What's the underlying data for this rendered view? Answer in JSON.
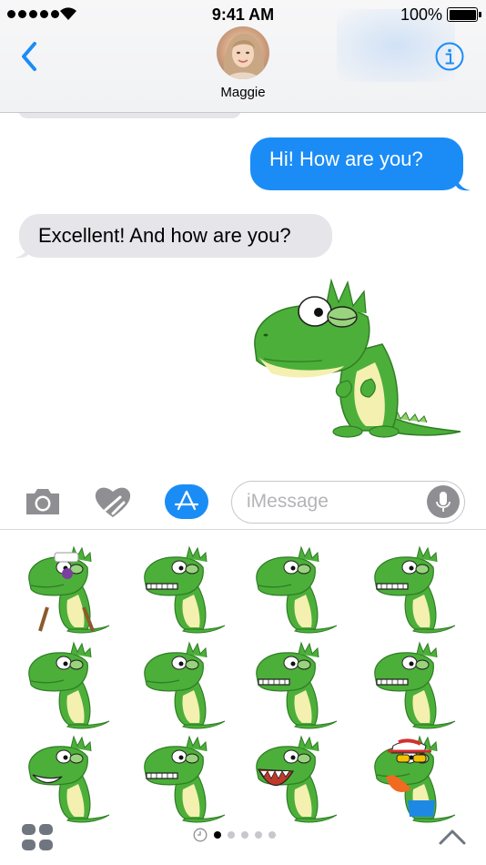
{
  "status_bar": {
    "time": "9:41 AM",
    "battery_percent": "100%",
    "battery_level": 1.0,
    "signal_bars": 5
  },
  "header": {
    "contact_name": "Maggie",
    "back_icon": "chevron-left-icon",
    "info_icon": "info-icon"
  },
  "messages": [
    {
      "direction": "outgoing",
      "text": "Hi! How are you?"
    },
    {
      "direction": "incoming",
      "text": "Excellent! And how are you?"
    }
  ],
  "sent_sticker": {
    "type": "sticker",
    "subject": "green-dinosaur-worried"
  },
  "input_bar": {
    "placeholder": "iMessage",
    "value": "",
    "icons": [
      "camera-icon",
      "digital-touch-heart-icon",
      "app-store-icon",
      "microphone-icon"
    ]
  },
  "sticker_drawer": {
    "rows": 3,
    "columns": 4,
    "stickers": [
      "dino-injured",
      "dino-angry",
      "dino-bored",
      "dino-nervous",
      "dino-pouting",
      "dino-grumpy",
      "dino-shocked",
      "dino-grinning",
      "dino-laughing",
      "dino-smiling",
      "dino-screaming",
      "dino-cool-cap"
    ],
    "page_count": 5,
    "active_page": 1
  },
  "colors": {
    "accent": "#1B8CF6",
    "outgoing_bubble": "#1B8CF6",
    "incoming_bubble": "#E5E5EA",
    "dino_green": "#4CAF3A",
    "dino_belly": "#F4F0B0"
  }
}
